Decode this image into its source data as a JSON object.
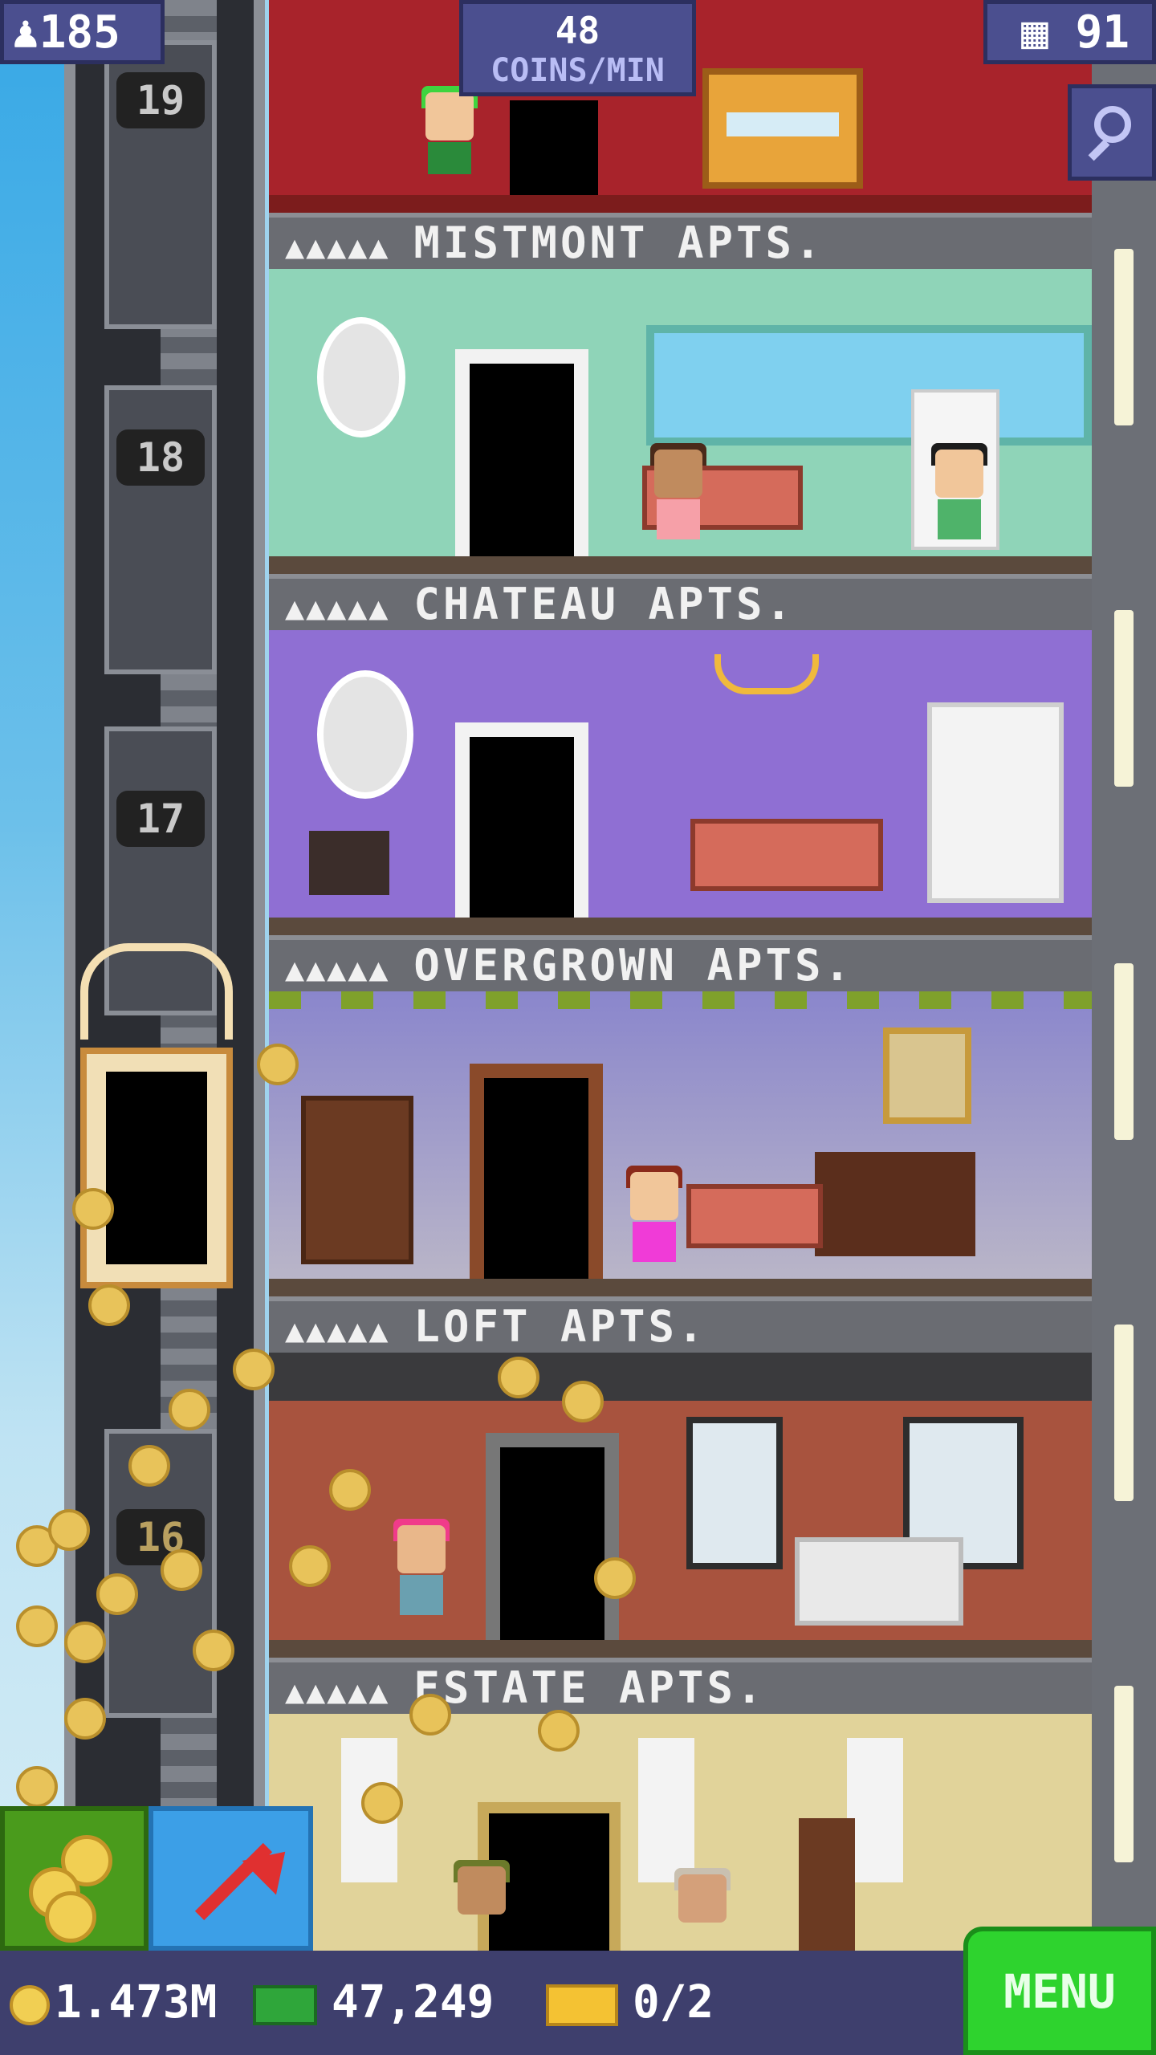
{
  "hud": {
    "population": "185",
    "rate_value": "48",
    "rate_unit": "COINS/MIN",
    "floor_count": "91"
  },
  "elevator": {
    "floor_labels": [
      "19",
      "18",
      "17",
      "16"
    ]
  },
  "floors": [
    {
      "name": "MISTMONT APTS.",
      "stars": "▲▲▲▲▲"
    },
    {
      "name": "CHATEAU APTS.",
      "stars": "▲▲▲▲▲"
    },
    {
      "name": "OVERGROWN APTS.",
      "stars": "▲▲▲▲▲"
    },
    {
      "name": "LOFT APTS.",
      "stars": "▲▲▲▲▲"
    },
    {
      "name": "ESTATE APTS.",
      "stars": "▲▲▲▲▲"
    }
  ],
  "bottom": {
    "coins": "1.473M",
    "bux": "47,249",
    "tickets": "0/2",
    "menu_label": "MENU"
  },
  "icons": {
    "population": "person-icon",
    "floors": "building-icon",
    "zoom": "magnifier-icon",
    "collect": "coins-icon",
    "elevator": "arrow-up-icon"
  },
  "colors": {
    "hud_panel": "#4b4f8f",
    "menu_green": "#2ed32e",
    "coin_gold": "#f1cf53"
  }
}
